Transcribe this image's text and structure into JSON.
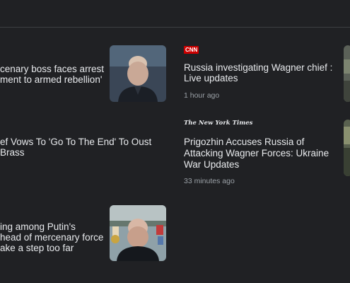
{
  "left_column": {
    "story1": {
      "line1": "cenary boss faces arrest",
      "line2": "ment to armed rebellion'"
    },
    "story2": {
      "line1": "ef Vows To 'Go To The End' To Oust",
      "line2": "Brass"
    },
    "story3": {
      "line1": "ing among Putin's",
      "line2": "head of mercenary force",
      "line3": "ake a step too far"
    }
  },
  "right_column": {
    "story1": {
      "source": "CNN",
      "line1": "Russia investigating Wagner chief :",
      "line2": "Live updates",
      "time": "1 hour ago"
    },
    "story2": {
      "source": "The New York Times",
      "line1": "Prigozhin Accuses Russia of",
      "line2": "Attacking Wagner Forces: Ukraine",
      "line3": "War Updates",
      "time": "33 minutes ago"
    }
  }
}
